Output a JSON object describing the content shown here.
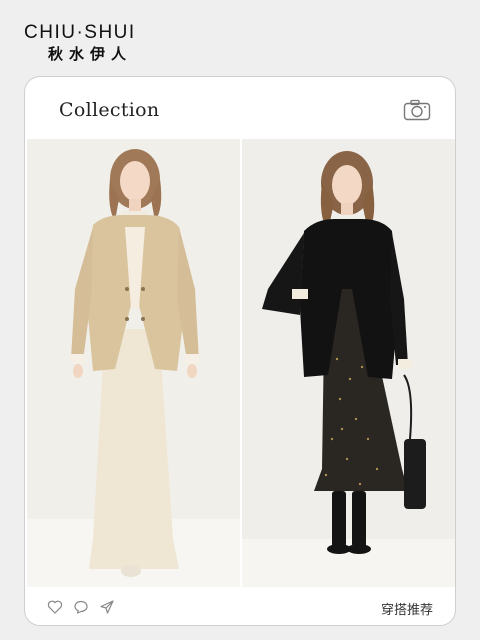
{
  "brand": {
    "name_en": "CHIU·SHUI",
    "name_cn": "秋水伊人"
  },
  "card": {
    "title": "Collection",
    "footer_label": "穿搭推荐",
    "icons": [
      "camera-icon",
      "heart-icon",
      "comment-icon",
      "share-icon"
    ]
  },
  "photos": [
    {
      "description_name": "beige blazer look"
    },
    {
      "description_name": "black blazer look"
    }
  ]
}
